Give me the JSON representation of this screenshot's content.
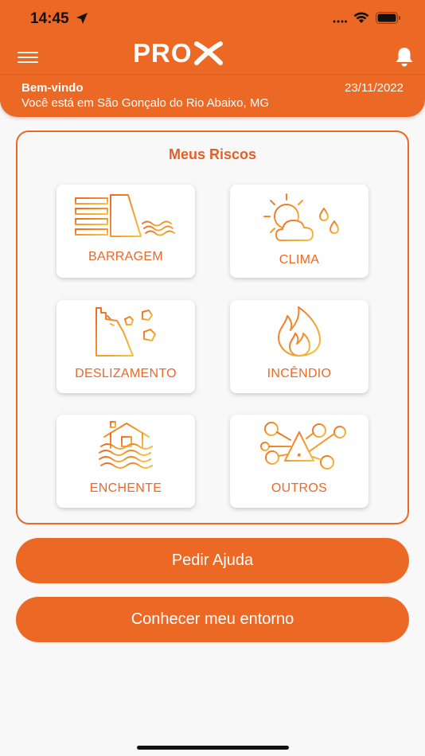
{
  "status_bar": {
    "time": "14:45"
  },
  "header": {
    "logo": "PRO",
    "welcome": "Bem-vindo",
    "date": "23/11/2022",
    "location": "Você está em São Gonçalo do Rio Abaixo, MG"
  },
  "risks": {
    "title": "Meus Riscos",
    "items": [
      {
        "label": "BARRAGEM",
        "icon": "dam-icon"
      },
      {
        "label": "CLIMA",
        "icon": "weather-icon"
      },
      {
        "label": "DESLIZAMENTO",
        "icon": "landslide-icon"
      },
      {
        "label": "INCÊNDIO",
        "icon": "fire-icon"
      },
      {
        "label": "ENCHENTE",
        "icon": "flood-icon"
      },
      {
        "label": "OUTROS",
        "icon": "network-warning-icon"
      }
    ]
  },
  "buttons": {
    "help": "Pedir Ajuda",
    "surroundings": "Conhecer meu entorno"
  },
  "colors": {
    "primary": "#ec6825",
    "icon_gradient_start": "#ee6a22",
    "icon_gradient_end": "#f6c23d",
    "background": "#f8f8f8"
  }
}
